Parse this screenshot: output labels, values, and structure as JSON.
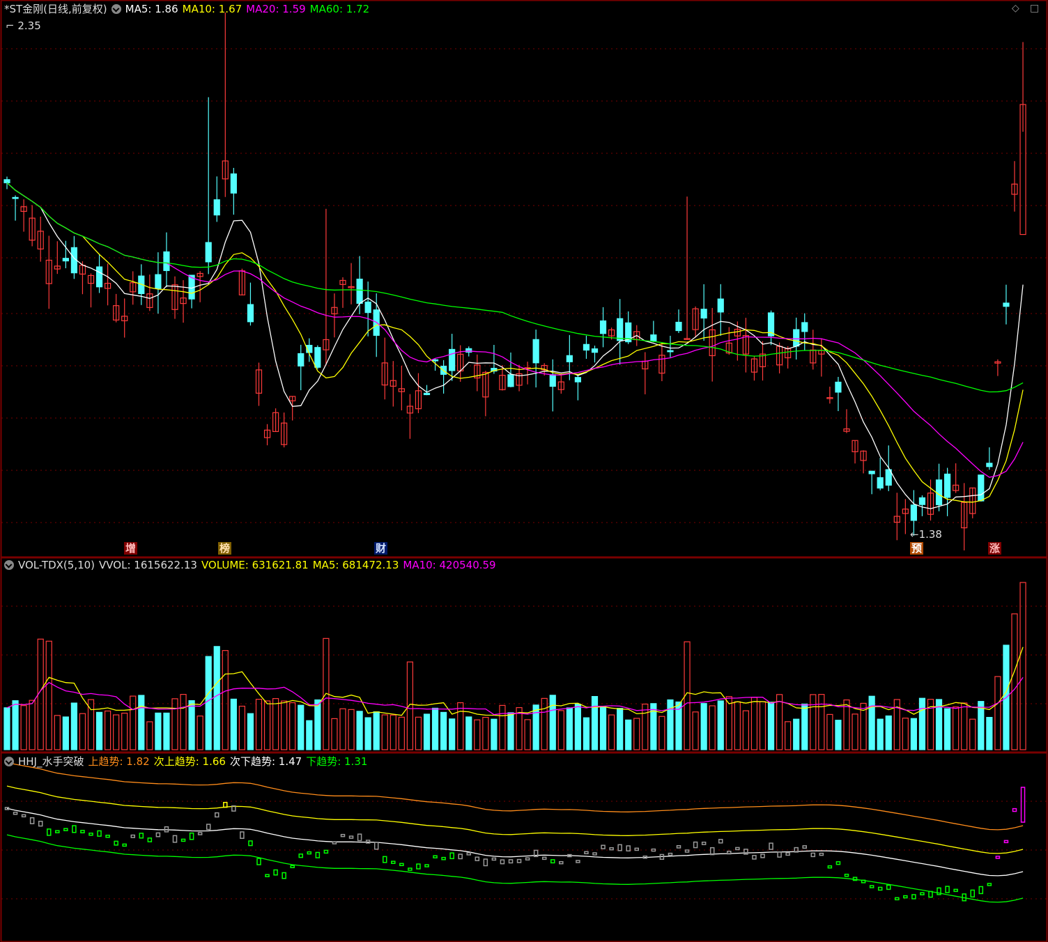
{
  "main": {
    "name_label": "*ST金刚(日线,前复权)",
    "ma5": "MA5: 1.86",
    "ma10": "MA10: 1.67",
    "ma20": "MA20: 1.59",
    "ma60": "MA60: 1.72",
    "high_label": "2.35",
    "low_label": "1.38",
    "markers": [
      "增",
      "榜",
      "财",
      "预",
      "涨"
    ]
  },
  "vol": {
    "indicator": "VOL-TDX(5,10)",
    "vvol": "VVOL: 1615622.13",
    "volume": "VOLUME: 631621.81",
    "ma5": "MA5: 681472.13",
    "ma10": "MA10: 420540.59"
  },
  "hhj": {
    "indicator": "HHJ_水手突破",
    "up": "上趋势: 1.82",
    "sub_up": "次上趋势: 1.66",
    "sub_down": "次下趋势: 1.47",
    "down": "下趋势: 1.31"
  },
  "colors": {
    "up": "#ff3b3b",
    "down": "#54ffff",
    "ma5": "#ffffff",
    "ma10": "#ffff00",
    "ma20": "#ff00ff",
    "ma60": "#00ff00",
    "grid": "#7a0000",
    "orange": "#ff8c1a"
  },
  "icons": [
    "dropdown-icon",
    "diamond-icon",
    "expand-icon"
  ]
}
